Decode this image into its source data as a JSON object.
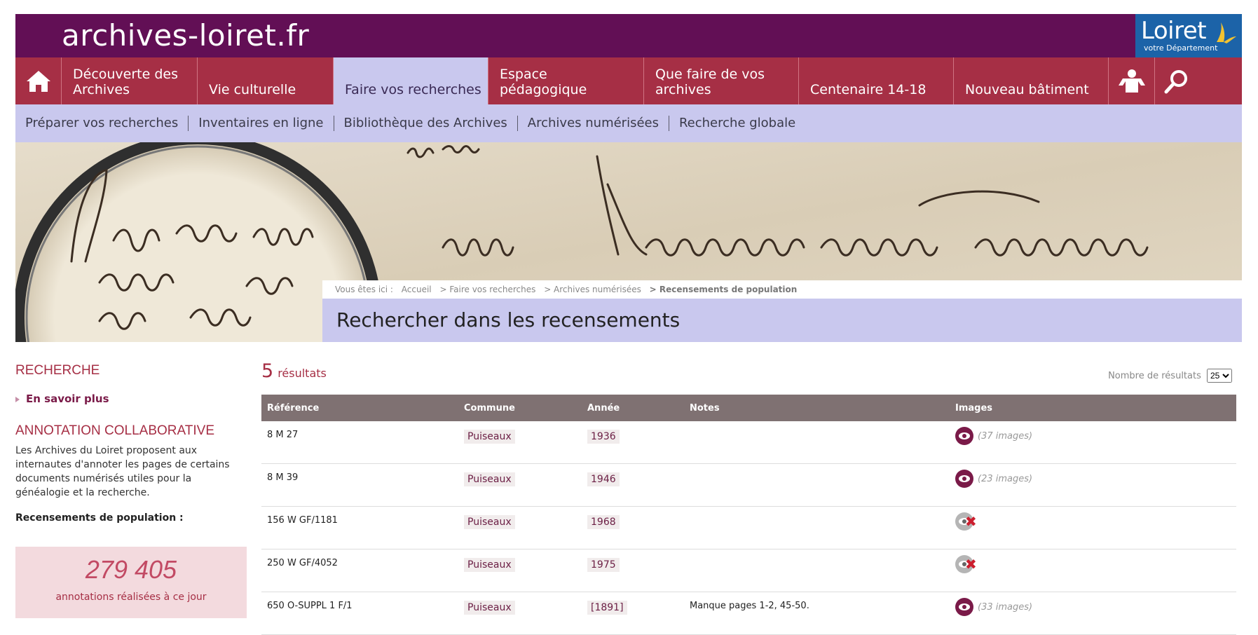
{
  "site": {
    "name": "archives-loiret.fr",
    "logo_word": "Loiret",
    "logo_sub": "votre Département"
  },
  "icons": {
    "home": "home-icon",
    "user": "user-icon",
    "search": "search-icon",
    "eye": "eye-icon",
    "unavailable": "unavailable-icon"
  },
  "colors": {
    "header": "#620f55",
    "nav": "#a62f45",
    "active_nav": "#c9c8ee",
    "accent": "#a62f45",
    "table_head": "#7f7172",
    "eye": "#7a1a48"
  },
  "nav": {
    "items": [
      {
        "label": "Découverte des Archives"
      },
      {
        "label": "Vie culturelle"
      },
      {
        "label": "Faire vos recherches",
        "active": true
      },
      {
        "label": "Espace pédagogique"
      },
      {
        "label": "Que faire de vos archives"
      },
      {
        "label": "Centenaire 14-18"
      },
      {
        "label": "Nouveau bâtiment"
      }
    ]
  },
  "subnav": {
    "items": [
      {
        "label": "Préparer vos recherches"
      },
      {
        "label": "Inventaires en ligne"
      },
      {
        "label": "Bibliothèque des Archives"
      },
      {
        "label": "Archives numérisées"
      },
      {
        "label": "Recherche globale"
      }
    ]
  },
  "breadcrumb": {
    "prefix": "Vous êtes ici :",
    "items": [
      "Accueil",
      "> Faire vos recherches",
      "> Archives numérisées",
      "> Recensements de population"
    ]
  },
  "page": {
    "title": "Rechercher dans les recensements"
  },
  "sidebar": {
    "heading1": "RECHERCHE",
    "link": "En savoir plus",
    "heading2": "ANNOTATION COLLABORATIVE",
    "text": "Les Archives du Loiret proposent aux internautes d'annoter les pages de certains documents numérisés utiles pour la généalogie et la recherche.",
    "strong": "Recensements de population :",
    "counter_value": "279 405",
    "counter_caption": "annotations réalisées à ce jour"
  },
  "results": {
    "count": "5",
    "count_label": "résultats",
    "per_page_label": "Nombre de résultats",
    "per_page_value": "25",
    "columns": [
      "Référence",
      "Commune",
      "Année",
      "Notes",
      "Images"
    ],
    "rows": [
      {
        "ref": "8 M 27",
        "commune": "Puiseaux",
        "year": "1936",
        "notes": "",
        "available": true,
        "images": "(37 images)"
      },
      {
        "ref": "8 M 39",
        "commune": "Puiseaux",
        "year": "1946",
        "notes": "",
        "available": true,
        "images": "(23 images)"
      },
      {
        "ref": "156 W GF/1181",
        "commune": "Puiseaux",
        "year": "1968",
        "notes": "",
        "available": false,
        "images": ""
      },
      {
        "ref": "250 W GF/4052",
        "commune": "Puiseaux",
        "year": "1975",
        "notes": "",
        "available": false,
        "images": ""
      },
      {
        "ref": "650 O-SUPPL 1 F/1",
        "commune": "Puiseaux",
        "year": "[1891]",
        "notes": "Manque pages 1-2, 45-50.",
        "available": true,
        "images": "(33 images)"
      }
    ]
  }
}
